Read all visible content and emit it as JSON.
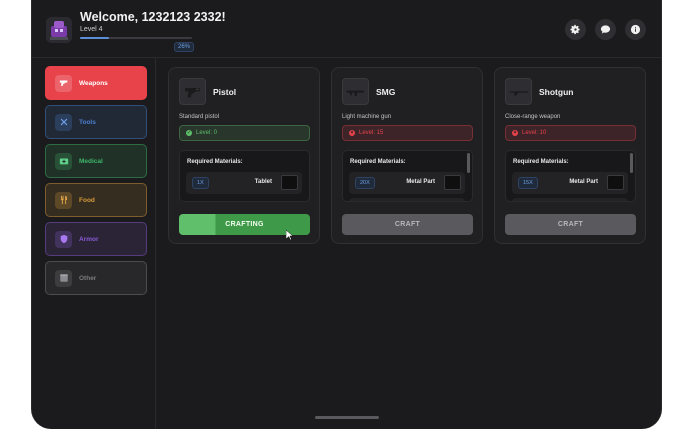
{
  "header": {
    "welcome": "Welcome, 1232123 2332!",
    "level": "Level 4",
    "xp_percent": "26%",
    "xp_fraction": 0.26
  },
  "header_buttons": [
    "gear-icon",
    "chat-icon",
    "info-icon"
  ],
  "sidebar": {
    "items": [
      {
        "label": "Weapons",
        "icon": "gun-icon",
        "color": "#e8434b",
        "selected": true
      },
      {
        "label": "Tools",
        "icon": "wrench-icon",
        "color": "#4a7fd1"
      },
      {
        "label": "Medical",
        "icon": "medkit-icon",
        "color": "#3fb56a"
      },
      {
        "label": "Food",
        "icon": "fork-knife-icon",
        "color": "#d89a3c"
      },
      {
        "label": "Armor",
        "icon": "shield-icon",
        "color": "#8a5ad6"
      },
      {
        "label": "Other",
        "icon": "box-icon",
        "color": "#7a7a80"
      }
    ]
  },
  "weapons": [
    {
      "name": "Pistol",
      "description": "Standard pistol",
      "level_req": "Level: 0",
      "level_ok": true,
      "materials_title": "Required Materials:",
      "material_qty": "1X",
      "material_name": "Tablet",
      "button": "CRAFTING",
      "crafting": true
    },
    {
      "name": "SMG",
      "description": "Light machine gun",
      "level_req": "Level: 15",
      "level_ok": false,
      "materials_title": "Required Materials:",
      "material_qty": "20X",
      "material_name": "Metal Part",
      "button": "CRAFT",
      "crafting": false
    },
    {
      "name": "Shotgun",
      "description": "Close-range weapon",
      "level_req": "Level: 10",
      "level_ok": false,
      "materials_title": "Required Materials:",
      "material_qty": "15X",
      "material_name": "Metal Part",
      "button": "CRAFT",
      "crafting": false
    }
  ],
  "colors": {
    "ok_green": "#5fbf6a",
    "locked_red": "#e8434b",
    "accent_blue": "#6ea0e6"
  }
}
